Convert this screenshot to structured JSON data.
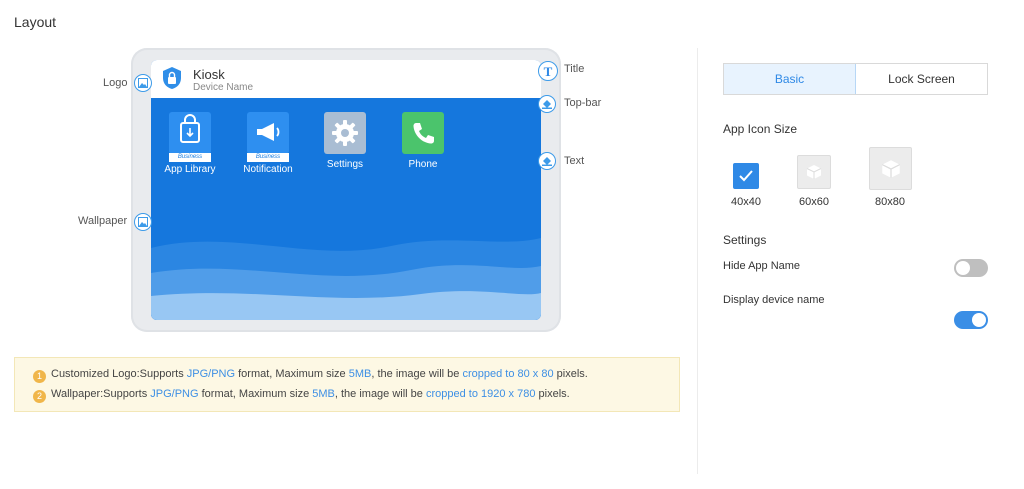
{
  "page": {
    "title": "Layout"
  },
  "preview": {
    "topbar": {
      "title": "Kiosk",
      "subtitle": "Device Name"
    },
    "apps": [
      {
        "label": "App Library",
        "badge": "Business",
        "icon": "shopping-bag-icon",
        "color": "#2e8ff0"
      },
      {
        "label": "Notification",
        "badge": "Business",
        "icon": "megaphone-icon",
        "color": "#2e8ff0"
      },
      {
        "label": "Settings",
        "badge": "",
        "icon": "gear-icon",
        "color": "#a9bdd3"
      },
      {
        "label": "Phone",
        "badge": "",
        "icon": "phone-icon",
        "color": "#4bc46c"
      }
    ],
    "callouts": {
      "logo": "Logo",
      "wallpaper": "Wallpaper",
      "title": "Title",
      "topbar": "Top-bar",
      "text": "Text"
    }
  },
  "notice": {
    "line1": {
      "num": "1",
      "a": "Customized Logo:Supports ",
      "fmt": "JPG/PNG",
      "b": " format, Maximum size ",
      "size": "5MB",
      "c": ", the image will be ",
      "crop": "cropped to 80 x 80",
      "d": " pixels."
    },
    "line2": {
      "num": "2",
      "a": "Wallpaper:Supports ",
      "fmt": "JPG/PNG",
      "b": " format, Maximum size ",
      "size": "5MB",
      "c": ", the image will be ",
      "crop": "cropped to 1920 x 780",
      "d": " pixels."
    }
  },
  "panel": {
    "tabs": [
      {
        "label": "Basic",
        "active": true
      },
      {
        "label": "Lock Screen",
        "active": false
      }
    ],
    "icon_size": {
      "title": "App Icon Size",
      "options": [
        {
          "label": "40x40",
          "selected": true
        },
        {
          "label": "60x60",
          "selected": false
        },
        {
          "label": "80x80",
          "selected": false
        }
      ]
    },
    "settings": {
      "title": "Settings",
      "hide_app_name": {
        "label": "Hide App Name",
        "on": false
      },
      "display_device_name": {
        "label": "Display device name",
        "on": true
      }
    }
  },
  "colors": {
    "accent": "#2f89e6",
    "toggle_on": "#3a8ee6",
    "toggle_off": "#bfbfbf",
    "notice_bg": "#fdf8e4"
  }
}
